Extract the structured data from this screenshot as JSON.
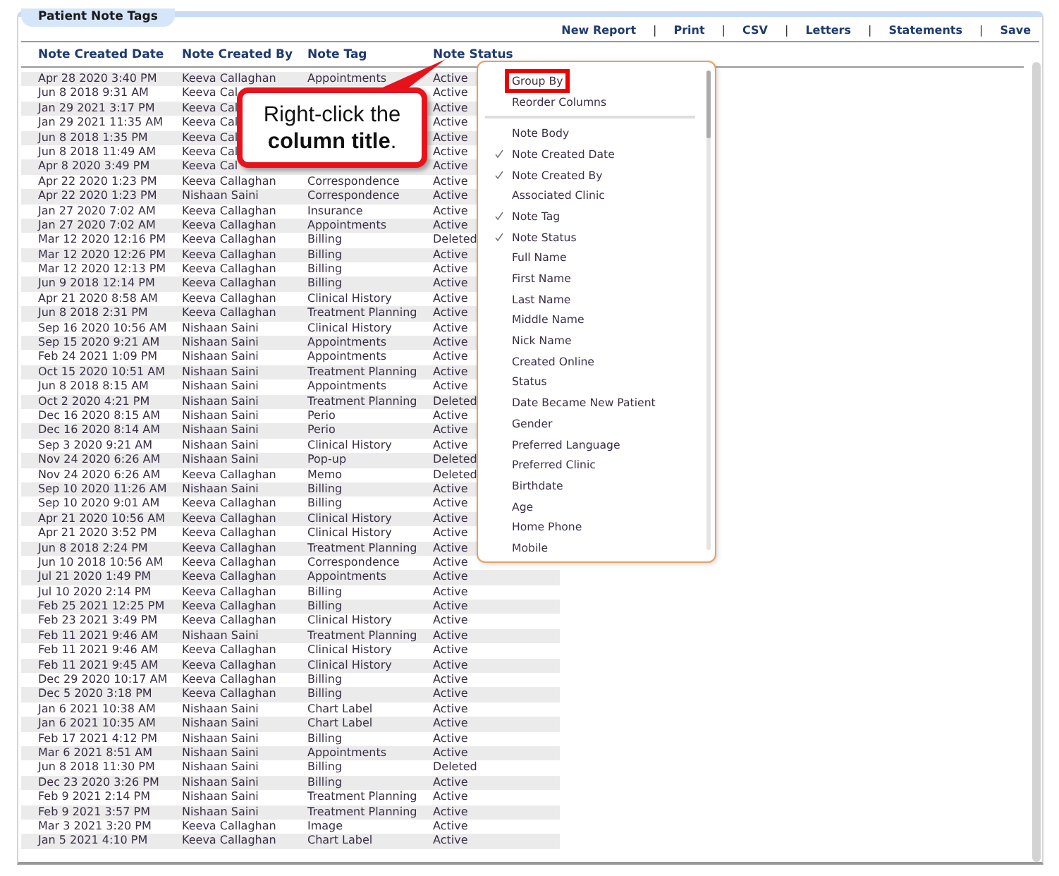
{
  "panel": {
    "title": "Patient Note Tags"
  },
  "toolbar": [
    {
      "kind": "link",
      "label": "New Report"
    },
    {
      "kind": "separator",
      "label": "|"
    },
    {
      "kind": "link",
      "label": "Print"
    },
    {
      "kind": "separator",
      "label": "|"
    },
    {
      "kind": "link",
      "label": "CSV"
    },
    {
      "kind": "separator",
      "label": "|"
    },
    {
      "kind": "link",
      "label": "Letters"
    },
    {
      "kind": "separator",
      "label": "|"
    },
    {
      "kind": "link",
      "label": "Statements"
    },
    {
      "kind": "separator",
      "label": "|"
    },
    {
      "kind": "link",
      "label": "Save"
    }
  ],
  "table": {
    "columns": [
      "Note Created Date",
      "Note Created By",
      "Note Tag",
      "Note Status"
    ],
    "rows": [
      [
        "Apr 28 2020 3:40 PM",
        "Keeva Callaghan",
        "Appointments",
        "Active"
      ],
      [
        "Jun 8 2018 9:31 AM",
        "Keeva Cal",
        null,
        "Active"
      ],
      [
        "Jan 29 2021 3:17 PM",
        "Keeva Cal",
        null,
        "Active"
      ],
      [
        "Jan 29 2021 11:35 AM",
        "Keeva Cal",
        null,
        "Active"
      ],
      [
        "Jun 8 2018 1:35 PM",
        "Keeva Cal",
        null,
        "Active"
      ],
      [
        "Jun 8 2018 11:49 AM",
        "Keeva Cal",
        null,
        "Active"
      ],
      [
        "Apr 8 2020 3:49 PM",
        "Keeva Cal",
        null,
        "Active"
      ],
      [
        "Apr 22 2020 1:23 PM",
        "Keeva Callaghan",
        "Correspondence",
        "Active"
      ],
      [
        "Apr 22 2020 1:23 PM",
        "Nishaan Saini",
        "Correspondence",
        "Active"
      ],
      [
        "Jan 27 2020 7:02 AM",
        "Keeva Callaghan",
        "Insurance",
        "Active"
      ],
      [
        "Jan 27 2020 7:02 AM",
        "Keeva Callaghan",
        "Appointments",
        "Active"
      ],
      [
        "Mar 12 2020 12:16 PM",
        "Keeva Callaghan",
        "Billing",
        "Deleted"
      ],
      [
        "Mar 12 2020 12:26 PM",
        "Keeva Callaghan",
        "Billing",
        "Active"
      ],
      [
        "Mar 12 2020 12:13 PM",
        "Keeva Callaghan",
        "Billing",
        "Active"
      ],
      [
        "Jun 9 2018 12:14 PM",
        "Keeva Callaghan",
        "Billing",
        "Active"
      ],
      [
        "Apr 21 2020 8:58 AM",
        "Keeva Callaghan",
        "Clinical History",
        "Active"
      ],
      [
        "Jun 8 2018 2:31 PM",
        "Keeva Callaghan",
        "Treatment Planning",
        "Active"
      ],
      [
        "Sep 16 2020 10:56 AM",
        "Nishaan Saini",
        "Clinical History",
        "Active"
      ],
      [
        "Sep 15 2020 9:21 AM",
        "Nishaan Saini",
        "Appointments",
        "Active"
      ],
      [
        "Feb 24 2021 1:09 PM",
        "Nishaan Saini",
        "Appointments",
        "Active"
      ],
      [
        "Oct 15 2020 10:51 AM",
        "Nishaan Saini",
        "Treatment Planning",
        "Active"
      ],
      [
        "Jun 8 2018 8:15 AM",
        "Nishaan Saini",
        "Appointments",
        "Active"
      ],
      [
        "Oct 2 2020 4:21 PM",
        "Nishaan Saini",
        "Treatment Planning",
        "Deleted"
      ],
      [
        "Dec 16 2020 8:15 AM",
        "Nishaan Saini",
        "Perio",
        "Active"
      ],
      [
        "Dec 16 2020 8:14 AM",
        "Nishaan Saini",
        "Perio",
        "Active"
      ],
      [
        "Sep 3 2020 9:21 AM",
        "Nishaan Saini",
        "Clinical History",
        "Active"
      ],
      [
        "Nov 24 2020 6:26 AM",
        "Nishaan Saini",
        "Pop-up",
        "Deleted"
      ],
      [
        "Nov 24 2020 6:26 AM",
        "Keeva Callaghan",
        "Memo",
        "Deleted"
      ],
      [
        "Sep 10 2020 11:26 AM",
        "Nishaan Saini",
        "Billing",
        "Active"
      ],
      [
        "Sep 10 2020 9:01 AM",
        "Keeva Callaghan",
        "Billing",
        "Active"
      ],
      [
        "Apr 21 2020 10:56 AM",
        "Keeva Callaghan",
        "Clinical History",
        "Active"
      ],
      [
        "Apr 21 2020 3:52 PM",
        "Keeva Callaghan",
        "Clinical History",
        "Active"
      ],
      [
        "Jun 8 2018 2:24 PM",
        "Keeva Callaghan",
        "Treatment Planning",
        "Active"
      ],
      [
        "Jun 10 2018 10:56 AM",
        "Keeva Callaghan",
        "Correspondence",
        "Active"
      ],
      [
        "Jul 21 2020 1:49 PM",
        "Keeva Callaghan",
        "Appointments",
        "Active"
      ],
      [
        "Jul 10 2020 2:14 PM",
        "Keeva Callaghan",
        "Billing",
        "Active"
      ],
      [
        "Feb 25 2021 12:25 PM",
        "Keeva Callaghan",
        "Billing",
        "Active"
      ],
      [
        "Feb 23 2021 3:49 PM",
        "Keeva Callaghan",
        "Clinical History",
        "Active"
      ],
      [
        "Feb 11 2021 9:46 AM",
        "Nishaan Saini",
        "Treatment Planning",
        "Active"
      ],
      [
        "Feb 11 2021 9:46 AM",
        "Keeva Callaghan",
        "Clinical History",
        "Active"
      ],
      [
        "Feb 11 2021 9:45 AM",
        "Keeva Callaghan",
        "Clinical History",
        "Active"
      ],
      [
        "Dec 29 2020 10:17 AM",
        "Keeva Callaghan",
        "Billing",
        "Active"
      ],
      [
        "Dec 5 2020 3:18 PM",
        "Keeva Callaghan",
        "Billing",
        "Active"
      ],
      [
        "Jan 6 2021 10:38 AM",
        "Nishaan Saini",
        "Chart Label",
        "Active"
      ],
      [
        "Jan 6 2021 10:35 AM",
        "Nishaan Saini",
        "Chart Label",
        "Active"
      ],
      [
        "Feb 17 2021 4:12 PM",
        "Nishaan Saini",
        "Billing",
        "Active"
      ],
      [
        "Mar 6 2021 8:51 AM",
        "Nishaan Saini",
        "Appointments",
        "Active"
      ],
      [
        "Jun 8 2018 11:30 PM",
        "Nishaan Saini",
        "Billing",
        "Deleted"
      ],
      [
        "Dec 23 2020 3:26 PM",
        "Nishaan Saini",
        "Billing",
        "Active"
      ],
      [
        "Feb 9 2021 2:14 PM",
        "Nishaan Saini",
        "Treatment Planning",
        "Active"
      ],
      [
        "Feb 9 2021 3:57 PM",
        "Nishaan Saini",
        "Treatment Planning",
        "Active"
      ],
      [
        "Mar 3 2021 3:20 PM",
        "Keeva Callaghan",
        "Image",
        "Active"
      ],
      [
        "Jan 5 2021 4:10 PM",
        "Keeva Callaghan",
        "Chart Label",
        "Active"
      ]
    ]
  },
  "context_menu": {
    "actions": [
      {
        "label": "Group By",
        "highlighted": true
      },
      {
        "label": "Reorder Columns",
        "highlighted": false
      }
    ],
    "columns": [
      {
        "label": "Note Body",
        "checked": false
      },
      {
        "label": "Note Created Date",
        "checked": true
      },
      {
        "label": "Note Created By",
        "checked": true
      },
      {
        "label": "Associated Clinic",
        "checked": false
      },
      {
        "label": "Note Tag",
        "checked": true
      },
      {
        "label": "Note Status",
        "checked": true
      },
      {
        "label": "Full Name",
        "checked": false
      },
      {
        "label": "First Name",
        "checked": false
      },
      {
        "label": "Last Name",
        "checked": false
      },
      {
        "label": "Middle Name",
        "checked": false
      },
      {
        "label": "Nick Name",
        "checked": false
      },
      {
        "label": "Created Online",
        "checked": false
      },
      {
        "label": "Status",
        "checked": false
      },
      {
        "label": "Date Became New Patient",
        "checked": false
      },
      {
        "label": "Gender",
        "checked": false
      },
      {
        "label": "Preferred Language",
        "checked": false
      },
      {
        "label": "Preferred Clinic",
        "checked": false
      },
      {
        "label": "Birthdate",
        "checked": false
      },
      {
        "label": "Age",
        "checked": false
      },
      {
        "label": "Home Phone",
        "checked": false
      },
      {
        "label": "Mobile",
        "checked": false
      }
    ]
  },
  "callout": {
    "text": "Right-click the **column title**."
  }
}
